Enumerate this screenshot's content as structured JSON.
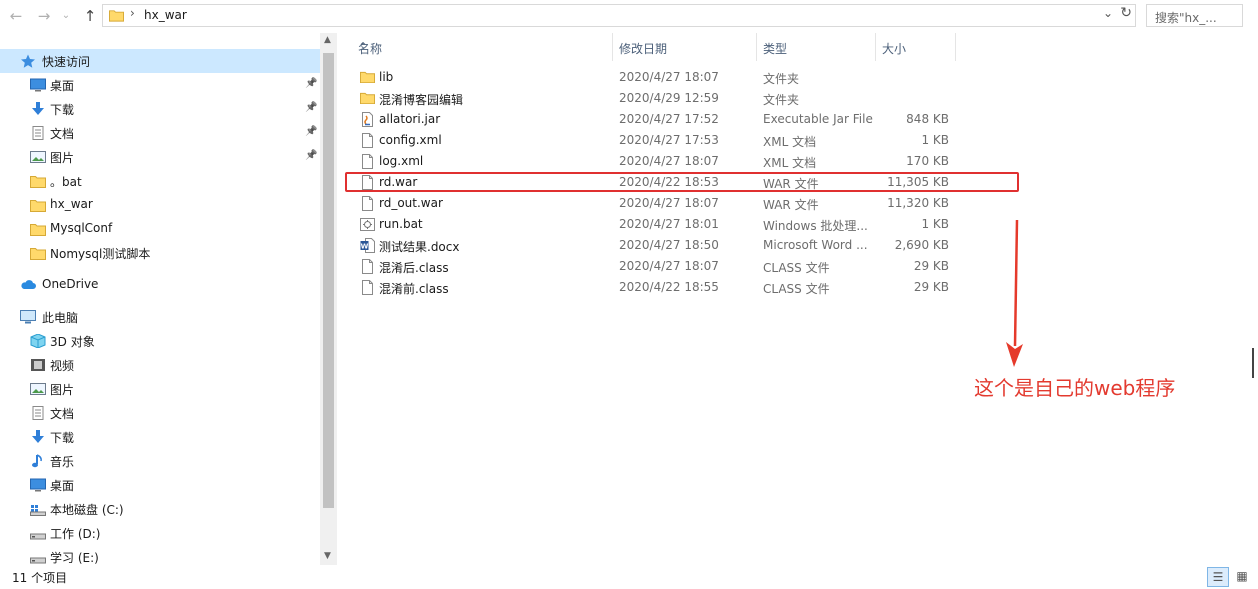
{
  "address": {
    "path": "hx_war",
    "search_placeholder": "搜索\"hx_..."
  },
  "nav": {
    "quick_access": "快速访问",
    "quick_items": [
      {
        "label": "桌面",
        "icon": "desktop-icon",
        "pinned": true
      },
      {
        "label": "下载",
        "icon": "download-icon",
        "pinned": true
      },
      {
        "label": "文档",
        "icon": "document-icon",
        "pinned": true
      },
      {
        "label": "图片",
        "icon": "picture-icon",
        "pinned": true
      },
      {
        "label": "。bat",
        "icon": "folder-icon",
        "pinned": false
      },
      {
        "label": "hx_war",
        "icon": "folder-icon",
        "pinned": false
      },
      {
        "label": "MysqlConf",
        "icon": "folder-icon",
        "pinned": false
      },
      {
        "label": "Nomysql测试脚本",
        "icon": "folder-icon",
        "pinned": false
      }
    ],
    "onedrive": "OneDrive",
    "this_pc": "此电脑",
    "pc_items": [
      {
        "label": "3D 对象",
        "icon": "3d-objects-icon"
      },
      {
        "label": "视频",
        "icon": "video-icon"
      },
      {
        "label": "图片",
        "icon": "picture-icon"
      },
      {
        "label": "文档",
        "icon": "document-icon"
      },
      {
        "label": "下载",
        "icon": "download-icon"
      },
      {
        "label": "音乐",
        "icon": "music-icon"
      },
      {
        "label": "桌面",
        "icon": "desktop-icon"
      },
      {
        "label": "本地磁盘 (C:)",
        "icon": "drive-c-icon"
      },
      {
        "label": "工作 (D:)",
        "icon": "drive-icon"
      },
      {
        "label": "学习 (E:)",
        "icon": "drive-icon"
      }
    ]
  },
  "columns": {
    "name": "名称",
    "date": "修改日期",
    "type": "类型",
    "size": "大小"
  },
  "files": [
    {
      "name": "lib",
      "date": "2020/4/27 18:07",
      "type": "文件夹",
      "size": "",
      "icon": "folder-icon"
    },
    {
      "name": "混淆博客园编辑",
      "date": "2020/4/29 12:59",
      "type": "文件夹",
      "size": "",
      "icon": "folder-icon"
    },
    {
      "name": "allatori.jar",
      "date": "2020/4/27 17:52",
      "type": "Executable Jar File",
      "size": "848 KB",
      "icon": "jar-icon"
    },
    {
      "name": "config.xml",
      "date": "2020/4/27 17:53",
      "type": "XML 文档",
      "size": "1 KB",
      "icon": "file-icon"
    },
    {
      "name": "log.xml",
      "date": "2020/4/27 18:07",
      "type": "XML 文档",
      "size": "170 KB",
      "icon": "file-icon"
    },
    {
      "name": "rd.war",
      "date": "2020/4/22 18:53",
      "type": "WAR 文件",
      "size": "11,305 KB",
      "icon": "file-icon"
    },
    {
      "name": "rd_out.war",
      "date": "2020/4/27 18:07",
      "type": "WAR 文件",
      "size": "11,320 KB",
      "icon": "file-icon"
    },
    {
      "name": "run.bat",
      "date": "2020/4/27 18:01",
      "type": "Windows 批处理...",
      "size": "1 KB",
      "icon": "bat-icon"
    },
    {
      "name": "测试结果.docx",
      "date": "2020/4/27 18:50",
      "type": "Microsoft Word ...",
      "size": "2,690 KB",
      "icon": "word-icon"
    },
    {
      "name": "混淆后.class",
      "date": "2020/4/27 18:07",
      "type": "CLASS 文件",
      "size": "29 KB",
      "icon": "file-icon"
    },
    {
      "name": "混淆前.class",
      "date": "2020/4/22 18:55",
      "type": "CLASS 文件",
      "size": "29 KB",
      "icon": "file-icon"
    }
  ],
  "annotation": {
    "text": "这个是自己的web程序",
    "color": "#e33a2f"
  },
  "status": {
    "count": "11 个项目"
  }
}
